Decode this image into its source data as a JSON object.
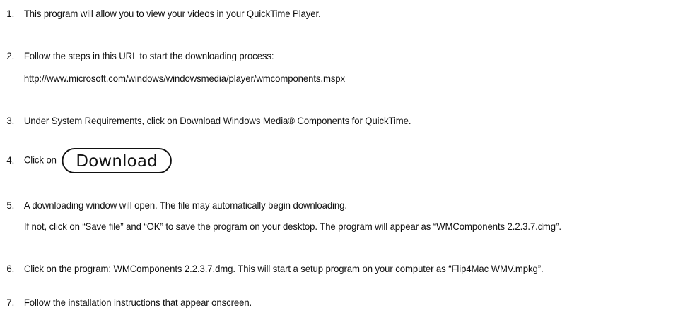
{
  "steps": [
    {
      "number": "1.",
      "text": "This program will allow you to view your videos in your QuickTime Player."
    },
    {
      "number": "2.",
      "text": "Follow the steps in this URL to start the downloading process:",
      "line2": "http://www.microsoft.com/windows/windowsmedia/player/wmcomponents.mspx"
    },
    {
      "number": "3.",
      "text": "Under System Requirements, click on Download Windows Media® Components for QuickTime."
    },
    {
      "number": "4.",
      "text": "Click on",
      "button_label": "Download"
    },
    {
      "number": "5.",
      "text": "A downloading window will open. The file may automatically begin downloading.",
      "line2": "If not, click on “Save file” and “OK” to save the program on your desktop. The program will appear as “WMComponents 2.2.3.7.dmg”."
    },
    {
      "number": "6.",
      "text": "Click on the program: WMComponents 2.2.3.7.dmg. This will start a setup program on your computer as “Flip4Mac WMV.mpkg”."
    },
    {
      "number": "7.",
      "text": "Follow the installation instructions that appear onscreen."
    }
  ]
}
